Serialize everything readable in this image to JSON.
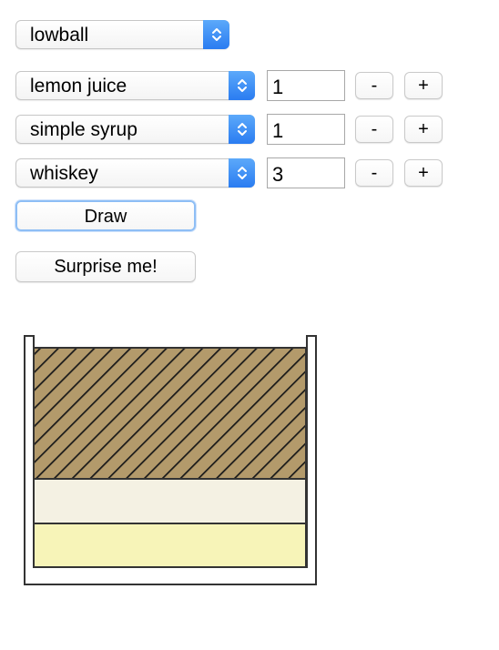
{
  "glass_select": {
    "value": "lowball"
  },
  "ingredients": [
    {
      "name": "lemon juice",
      "quantity": "1",
      "minus_label": "-",
      "plus_label": "+"
    },
    {
      "name": "simple syrup",
      "quantity": "1",
      "minus_label": "-",
      "plus_label": "+"
    },
    {
      "name": "whiskey",
      "quantity": "3",
      "minus_label": "-",
      "plus_label": "+"
    }
  ],
  "draw_button": {
    "label": "Draw"
  },
  "surprise_button": {
    "label": "Surprise me!"
  },
  "drawing": {
    "glass": "lowball",
    "layers_bottom_to_top": [
      {
        "ingredient": "lemon juice",
        "parts": 1,
        "color": "#f7f4b8",
        "pattern": "solid"
      },
      {
        "ingredient": "simple syrup",
        "parts": 1,
        "color": "#f4f1e3",
        "pattern": "solid"
      },
      {
        "ingredient": "whiskey",
        "parts": 3,
        "color": "#b39a6b",
        "pattern": "diagonal-hatch"
      }
    ],
    "outline_color": "#333333"
  },
  "colors": {
    "select_accent": "#2f84f4",
    "focus_ring": "#8ebef5"
  }
}
